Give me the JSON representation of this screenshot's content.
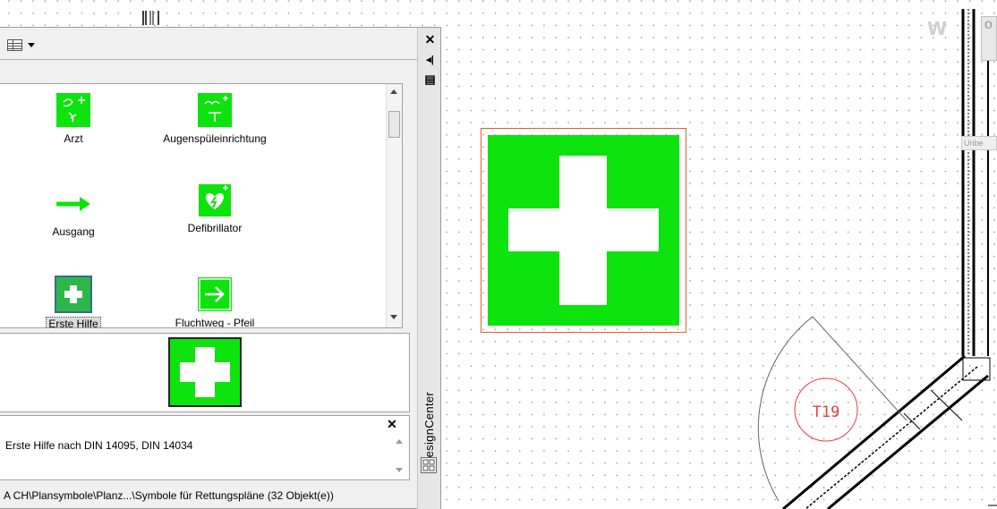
{
  "palette": {
    "title": "DesignCenter",
    "toolbar": {
      "views_icon": "views-icon"
    },
    "side_controls": {
      "close_glyph": "✕",
      "autohide_glyph": "◂|",
      "properties_glyph": "▤"
    },
    "items": [
      {
        "label": "Arzt",
        "icon": "doctor-sign-icon"
      },
      {
        "label": "Augenspüleinrichtung",
        "icon": "eye-wash-sign-icon"
      },
      {
        "label": "Ausgang",
        "icon": "exit-arrow-icon"
      },
      {
        "label": "Defibrillator",
        "icon": "defibrillator-sign-icon"
      },
      {
        "label": "Erste Hilfe",
        "icon": "first-aid-sign-icon",
        "selected": true
      },
      {
        "label": "Fluchtweg - Pfeil",
        "icon": "escape-route-arrow-icon"
      }
    ],
    "description": "Erste Hilfe nach DIN 14095, DIN 14034",
    "status": "A CH\\Plansymbole\\Planz...\\Symbole für Rettungspläne (32 Objekt(e))"
  },
  "canvas": {
    "door_tag": "T19",
    "corner_letter": "W",
    "wall_tab_text": "o",
    "wall_tag": "Unbe"
  },
  "colors": {
    "sign_green": "#0de30d",
    "selection": "#e06030",
    "door_tag": "#e04040"
  }
}
